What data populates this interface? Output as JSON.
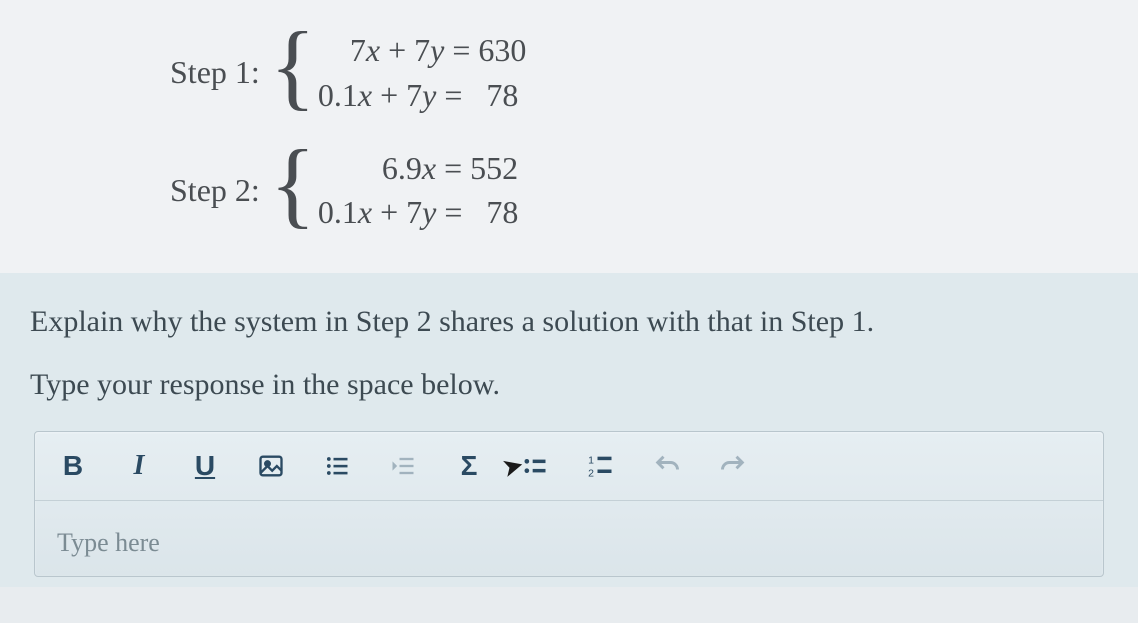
{
  "steps": [
    {
      "label": "Step 1:",
      "eq1_lhs": "7x + 7y",
      "eq1_rhs": "630",
      "eq2_lhs": "0.1x + 7y",
      "eq2_rhs": "78"
    },
    {
      "label": "Step 2:",
      "eq1_lhs": "6.9x",
      "eq1_rhs": "552",
      "eq2_lhs": "0.1x + 7y",
      "eq2_rhs": "78"
    }
  ],
  "prompt": {
    "line1": "Explain why the system in Step 2 shares a solution with that in Step 1.",
    "line2": "Type your response in the space below."
  },
  "toolbar": {
    "bold": "B",
    "italic": "I",
    "underline": "U",
    "sigma": "Σ"
  },
  "editor": {
    "placeholder": "Type here"
  }
}
